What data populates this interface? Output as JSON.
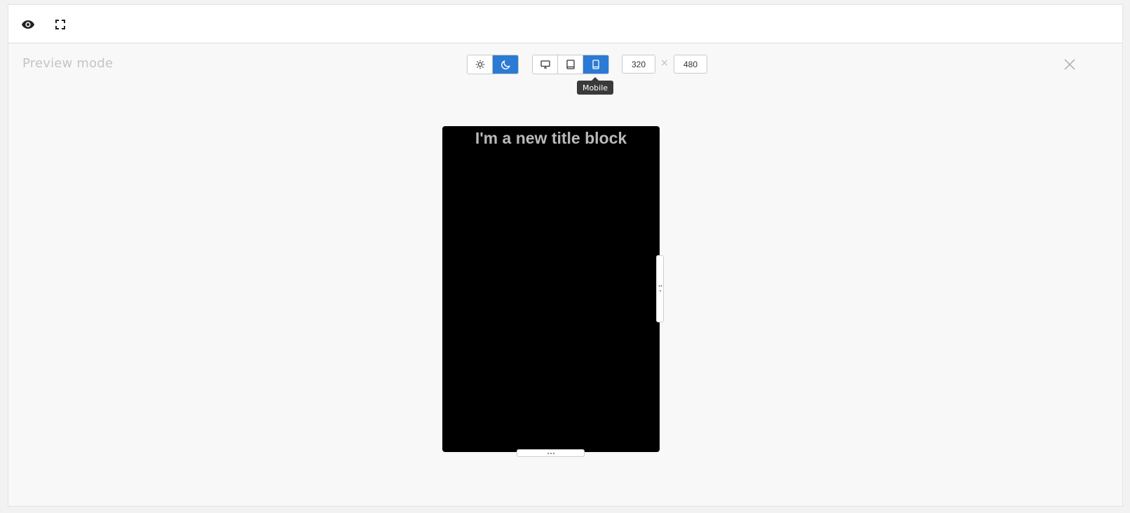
{
  "toolbar": {
    "preview_icon": "eye-icon",
    "fullscreen_icon": "fullscreen-icon"
  },
  "preview": {
    "mode_label": "Preview mode",
    "theme_buttons": [
      {
        "icon": "sun-icon",
        "label": "Light",
        "active": false
      },
      {
        "icon": "moon-icon",
        "label": "Dark",
        "active": true
      }
    ],
    "device_buttons": [
      {
        "icon": "desktop-icon",
        "label": "Desktop",
        "active": false
      },
      {
        "icon": "tablet-icon",
        "label": "Tablet",
        "active": false
      },
      {
        "icon": "mobile-icon",
        "label": "Mobile",
        "active": true
      }
    ],
    "tooltip": "Mobile",
    "width_value": "320",
    "height_value": "480",
    "separator": "×",
    "close_icon": "close-icon"
  },
  "canvas": {
    "title_block": "I'm a new title block",
    "background": "#000000",
    "title_color": "#b9b9b9"
  },
  "colors": {
    "accent": "#2b7ad4"
  }
}
